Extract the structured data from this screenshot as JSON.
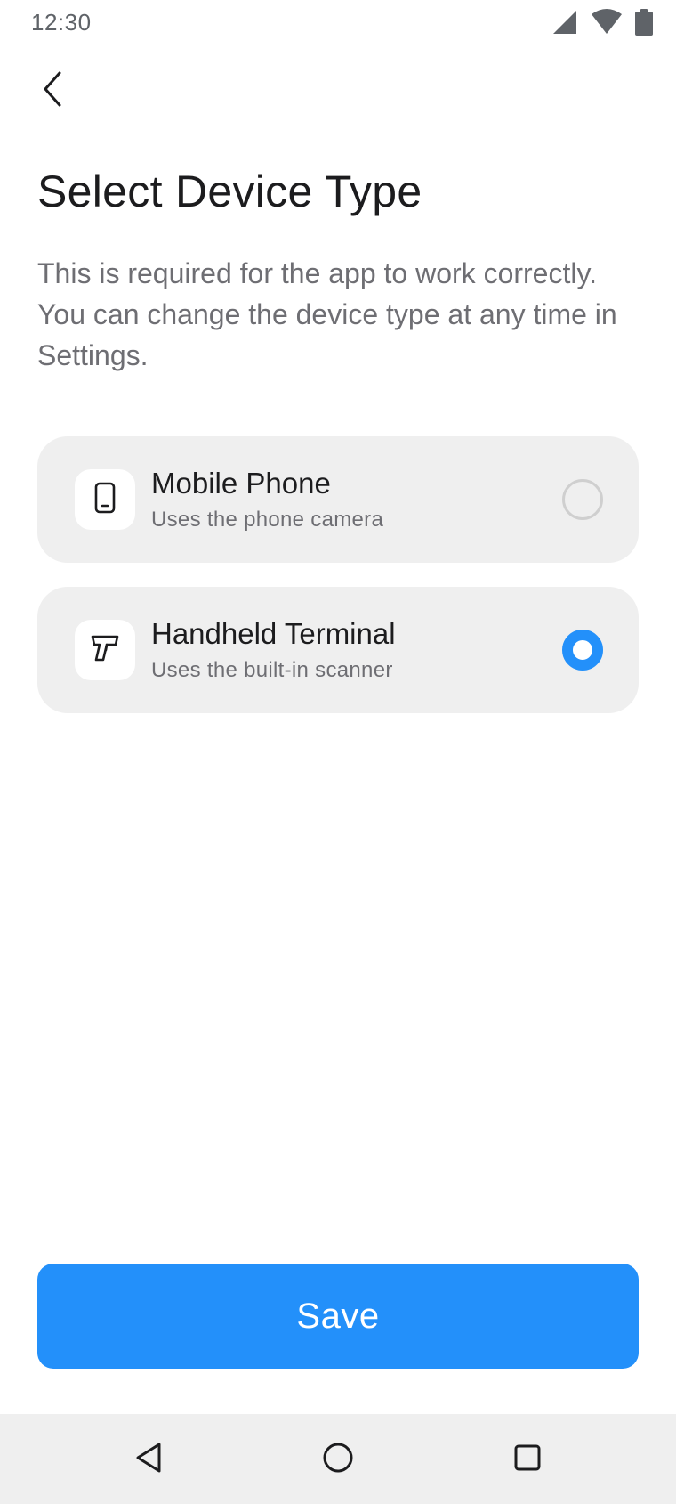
{
  "status_bar": {
    "time": "12:30",
    "icons": [
      "signal-icon",
      "wifi-icon",
      "battery-icon"
    ]
  },
  "header": {
    "back_icon": "chevron-left-icon",
    "title": "Select Device Type",
    "subtitle": "This is required for the app to work correctly. You can change the device type at any time in Settings."
  },
  "options": [
    {
      "title": "Mobile Phone",
      "description": "Uses the phone camera",
      "icon": "smartphone-icon",
      "selected": false
    },
    {
      "title": "Handheld Terminal",
      "description": "Uses the built-in scanner",
      "icon": "scanner-gun-icon",
      "selected": true
    }
  ],
  "actions": {
    "save_label": "Save"
  },
  "nav_bar": {
    "buttons": [
      "nav-back-icon",
      "nav-home-icon",
      "nav-recent-icon"
    ]
  },
  "colors": {
    "accent": "#2390fa",
    "card_background": "#efefef",
    "title_text": "#1c1c1e",
    "secondary_text": "#6e6e73"
  }
}
